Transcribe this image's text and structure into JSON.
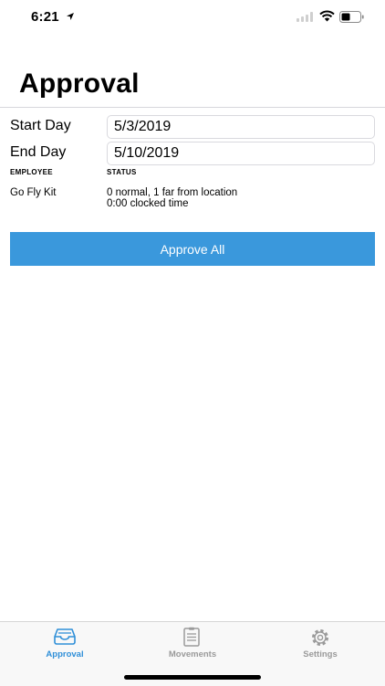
{
  "status_bar": {
    "time": "6:21"
  },
  "header": {
    "title": "Approval"
  },
  "form": {
    "start_label": "Start Day",
    "start_value": "5/3/2019",
    "end_label": "End Day",
    "end_value": "5/10/2019"
  },
  "table": {
    "headers": [
      "EMPLOYEE",
      "STATUS"
    ],
    "rows": [
      {
        "employee": "Go Fly Kit",
        "status_line1": "0 normal, 1 far from location",
        "status_line2": "0:00 clocked time"
      }
    ]
  },
  "actions": {
    "approve_all": "Approve All"
  },
  "tabs": [
    {
      "label": "Approval",
      "icon": "inbox-icon",
      "active": true
    },
    {
      "label": "Movements",
      "icon": "clipboard-list-icon",
      "active": false
    },
    {
      "label": "Settings",
      "icon": "gear-icon",
      "active": false
    }
  ],
  "colors": {
    "accent": "#2f8fd8",
    "button": "#3a98dc",
    "inactive": "#9a9a9a"
  }
}
